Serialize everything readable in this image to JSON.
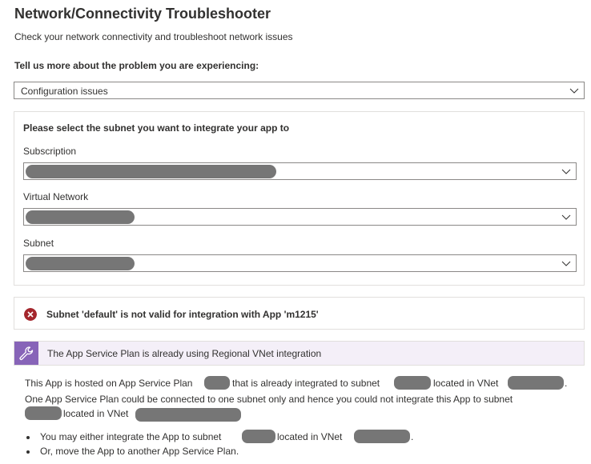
{
  "header": {
    "title": "Network/Connectivity Troubleshooter",
    "subtitle": "Check your network connectivity and troubleshoot network issues"
  },
  "problem": {
    "question": "Tell us more about the problem you are experiencing:",
    "selected": "Configuration issues"
  },
  "subnet_panel": {
    "title": "Please select the subnet you want to integrate your app to",
    "subscription_label": "Subscription",
    "vnet_label": "Virtual Network",
    "subnet_label": "Subnet"
  },
  "error": {
    "message": "Subnet 'default' is not valid for integration with App 'm1215'"
  },
  "info": {
    "banner": "The App Service Plan is already using Regional VNet integration",
    "p1_a": "This App is hosted on App Service Plan",
    "p1_b": "that is already integrated to subnet",
    "p1_c": "located in VNet",
    "p1_d": ".",
    "p2": "One App Service Plan could be connected to one subnet only and hence you could not integrate this App to subnet",
    "p3": "located in VNet",
    "bullet1_a": "You may either integrate the App to subnet",
    "bullet1_b": "located in VNet",
    "bullet1_c": ".",
    "bullet2": "Or, move the App to another App Service Plan."
  },
  "icons": {
    "chevron": "chevron-down-icon",
    "error": "error-circle-icon",
    "wrench": "wrench-icon"
  },
  "colors": {
    "error": "#a4262c",
    "info_accent": "#8764b8",
    "info_bg": "#f4eff8",
    "redaction": "#767676"
  }
}
